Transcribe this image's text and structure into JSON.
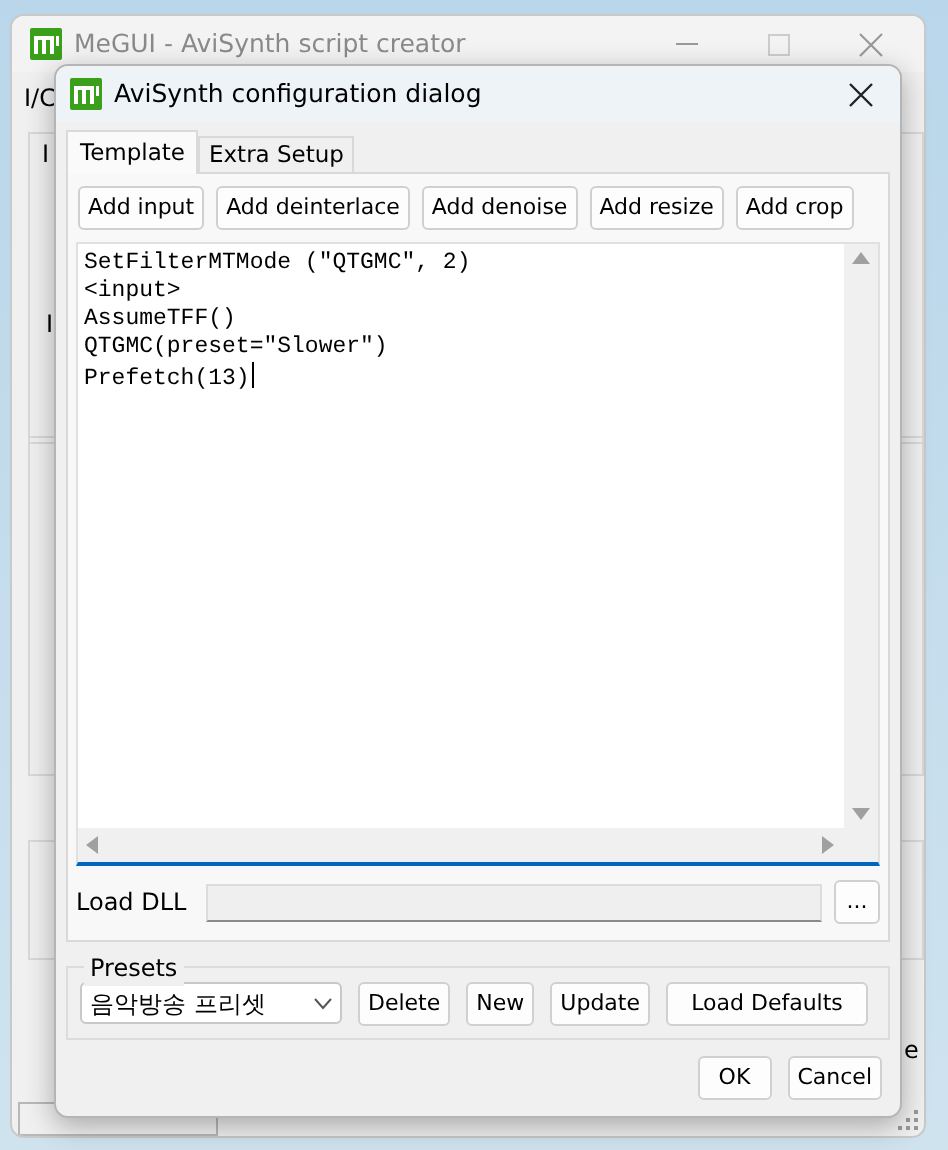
{
  "background_window": {
    "title": "MeGUI - AviSynth script creator",
    "tab": "I/C",
    "fragments": [
      "I",
      "I",
      "e"
    ]
  },
  "dialog": {
    "title": "AviSynth configuration dialog",
    "tabs": [
      {
        "label": "Template",
        "selected": true
      },
      {
        "label": "Extra Setup",
        "selected": false
      }
    ],
    "template_buttons": [
      "Add input",
      "Add deinterlace",
      "Add denoise",
      "Add resize",
      "Add crop"
    ],
    "script_lines": [
      "SetFilterMTMode (\"QTGMC\", 2)",
      "<input>",
      "AssumeTFF()",
      "QTGMC(preset=\"Slower\")",
      "Prefetch(13)"
    ],
    "load_dll": {
      "label": "Load DLL",
      "browse": "..."
    },
    "presets": {
      "title": "Presets",
      "selected_preset": "음악방송 프리셋",
      "buttons": [
        "Delete",
        "New",
        "Update",
        "Load Defaults"
      ]
    },
    "buttons": [
      "OK",
      "Cancel"
    ]
  }
}
